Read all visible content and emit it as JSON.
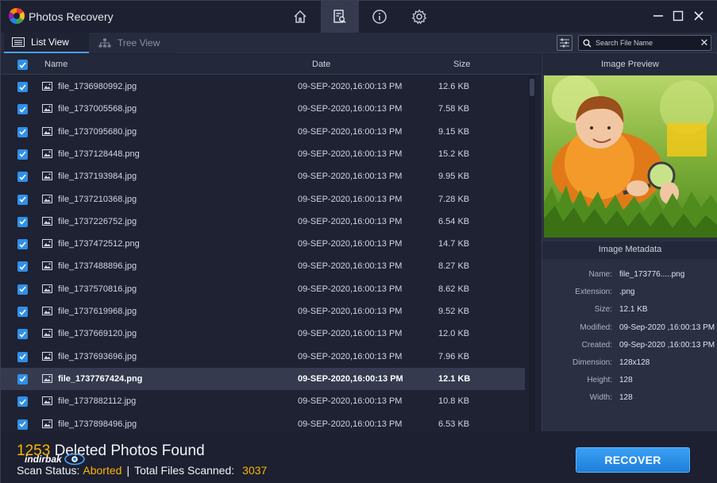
{
  "app": {
    "title": "Photos Recovery"
  },
  "toolbar": {
    "icons": [
      {
        "name": "home-icon",
        "active": false
      },
      {
        "name": "scan-results-icon",
        "active": true
      },
      {
        "name": "info-icon",
        "active": false
      },
      {
        "name": "settings-icon",
        "active": false
      }
    ]
  },
  "window_controls": [
    "minimize-icon",
    "maximize-icon",
    "close-icon"
  ],
  "tabs": {
    "list_view": "List View",
    "tree_view": "Tree View",
    "active": "list_view"
  },
  "search": {
    "placeholder": "Search File Name"
  },
  "table": {
    "columns": {
      "name": "Name",
      "date": "Date",
      "size": "Size"
    },
    "rows": [
      {
        "name": "file_1736980992.jpg",
        "date": "09-SEP-2020,16:00:13 PM",
        "size": "12.6 KB",
        "checked": true,
        "selected": false
      },
      {
        "name": "file_1737005568.jpg",
        "date": "09-SEP-2020,16:00:13 PM",
        "size": "7.58 KB",
        "checked": true,
        "selected": false
      },
      {
        "name": "file_1737095680.jpg",
        "date": "09-SEP-2020,16:00:13 PM",
        "size": "9.15 KB",
        "checked": true,
        "selected": false
      },
      {
        "name": "file_1737128448.png",
        "date": "09-SEP-2020,16:00:13 PM",
        "size": "15.2 KB",
        "checked": true,
        "selected": false
      },
      {
        "name": "file_1737193984.jpg",
        "date": "09-SEP-2020,16:00:13 PM",
        "size": "9.95 KB",
        "checked": true,
        "selected": false
      },
      {
        "name": "file_1737210368.jpg",
        "date": "09-SEP-2020,16:00:13 PM",
        "size": "7.28 KB",
        "checked": true,
        "selected": false
      },
      {
        "name": "file_1737226752.jpg",
        "date": "09-SEP-2020,16:00:13 PM",
        "size": "6.54 KB",
        "checked": true,
        "selected": false
      },
      {
        "name": "file_1737472512.png",
        "date": "09-SEP-2020,16:00:13 PM",
        "size": "14.7 KB",
        "checked": true,
        "selected": false
      },
      {
        "name": "file_1737488896.jpg",
        "date": "09-SEP-2020,16:00:13 PM",
        "size": "8.27 KB",
        "checked": true,
        "selected": false
      },
      {
        "name": "file_1737570816.jpg",
        "date": "09-SEP-2020,16:00:13 PM",
        "size": "8.62 KB",
        "checked": true,
        "selected": false
      },
      {
        "name": "file_1737619968.jpg",
        "date": "09-SEP-2020,16:00:13 PM",
        "size": "9.52 KB",
        "checked": true,
        "selected": false
      },
      {
        "name": "file_1737669120.jpg",
        "date": "09-SEP-2020,16:00:13 PM",
        "size": "12.0 KB",
        "checked": true,
        "selected": false
      },
      {
        "name": "file_1737693696.jpg",
        "date": "09-SEP-2020,16:00:13 PM",
        "size": "7.96 KB",
        "checked": true,
        "selected": false
      },
      {
        "name": "file_1737767424.png",
        "date": "09-SEP-2020,16:00:13 PM",
        "size": "12.1 KB",
        "checked": true,
        "selected": true
      },
      {
        "name": "file_1737882112.jpg",
        "date": "09-SEP-2020,16:00:13 PM",
        "size": "10.8 KB",
        "checked": true,
        "selected": false
      },
      {
        "name": "file_1737898496.jpg",
        "date": "09-SEP-2020,16:00:13 PM",
        "size": "6.53 KB",
        "checked": true,
        "selected": false
      }
    ]
  },
  "preview": {
    "title": "Image Preview",
    "metadata_title": "Image Metadata",
    "metadata": [
      {
        "key": "Name:",
        "value": "file_173776.....png"
      },
      {
        "key": "Extension:",
        "value": ".png"
      },
      {
        "key": "Size:",
        "value": "12.1 KB"
      },
      {
        "key": "Modified:",
        "value": "09-Sep-2020 ,16:00:13 PM"
      },
      {
        "key": "Created:",
        "value": "09-Sep-2020 ,16:00:13 PM"
      },
      {
        "key": "Dimension:",
        "value": "128x128"
      },
      {
        "key": "Height:",
        "value": "128"
      },
      {
        "key": "Width:",
        "value": "128"
      }
    ]
  },
  "footer": {
    "found_count": "1253",
    "found_label": "Deleted Photos Found",
    "scan_status_label": "Scan Status:",
    "scan_status_value": "Aborted",
    "separator": "|",
    "total_label": "Total Files Scanned:",
    "total_value": "3037",
    "watermark": "indirbak"
  },
  "recover_button": {
    "label": "RECOVER"
  },
  "colors": {
    "accent": "#2f8fe8",
    "highlight": "#ffb300",
    "background": "#1e2233",
    "selected_row": "#353a4f"
  }
}
